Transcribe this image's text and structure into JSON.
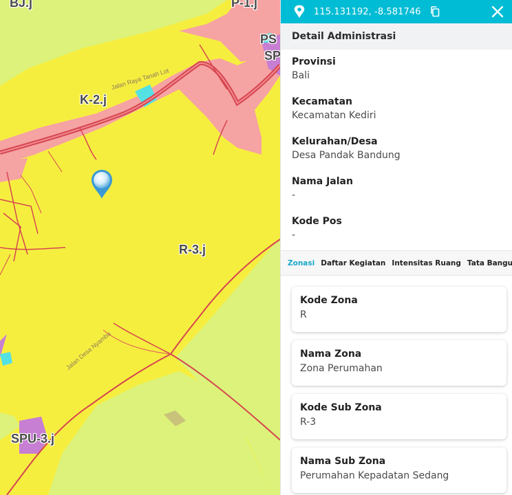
{
  "map": {
    "zone_labels": {
      "bj": "BJ.j",
      "p1": "P-1.j",
      "ps": "PS",
      "sp": "SP",
      "k2": "K-2.j",
      "r3": "R-3.j",
      "spu3": "SPU-3.j"
    },
    "road_labels": {
      "main": "Jalan Raya Tanah Lot",
      "side": "Jalan Desa Nyambu"
    },
    "marker_icon": "location-marker-icon",
    "colors": {
      "residential": "#f6ee3f",
      "agriculture": "#dcf27a",
      "commercial": "#f6a3a3",
      "road": "#e0575c",
      "public_facility": "#c77fd3",
      "open_space": "#54e1e3"
    }
  },
  "panel": {
    "coordinates": "115.131192, -8.581746",
    "section_title": "Detail Administrasi",
    "fields": [
      {
        "label": "Provinsi",
        "value": "Bali"
      },
      {
        "label": "Kecamatan",
        "value": "Kecamatan Kediri"
      },
      {
        "label": "Kelurahan/Desa",
        "value": "Desa Pandak Bandung"
      },
      {
        "label": "Nama Jalan",
        "value": "-"
      },
      {
        "label": "Kode Pos",
        "value": "-"
      }
    ],
    "tabs": [
      {
        "label": "Zonasi",
        "active": true
      },
      {
        "label": "Daftar Kegiatan",
        "active": false
      },
      {
        "label": "Intensitas Ruang",
        "active": false
      },
      {
        "label": "Tata Bangunan",
        "active": false
      }
    ],
    "cards": [
      {
        "label": "Kode Zona",
        "value": "R"
      },
      {
        "label": "Nama Zona",
        "value": "Zona Perumahan"
      },
      {
        "label": "Kode Sub Zona",
        "value": "R-3"
      },
      {
        "label": "Nama Sub Zona",
        "value": "Perumahan Kepadatan Sedang"
      }
    ],
    "accent_color": "#00bcd4"
  }
}
